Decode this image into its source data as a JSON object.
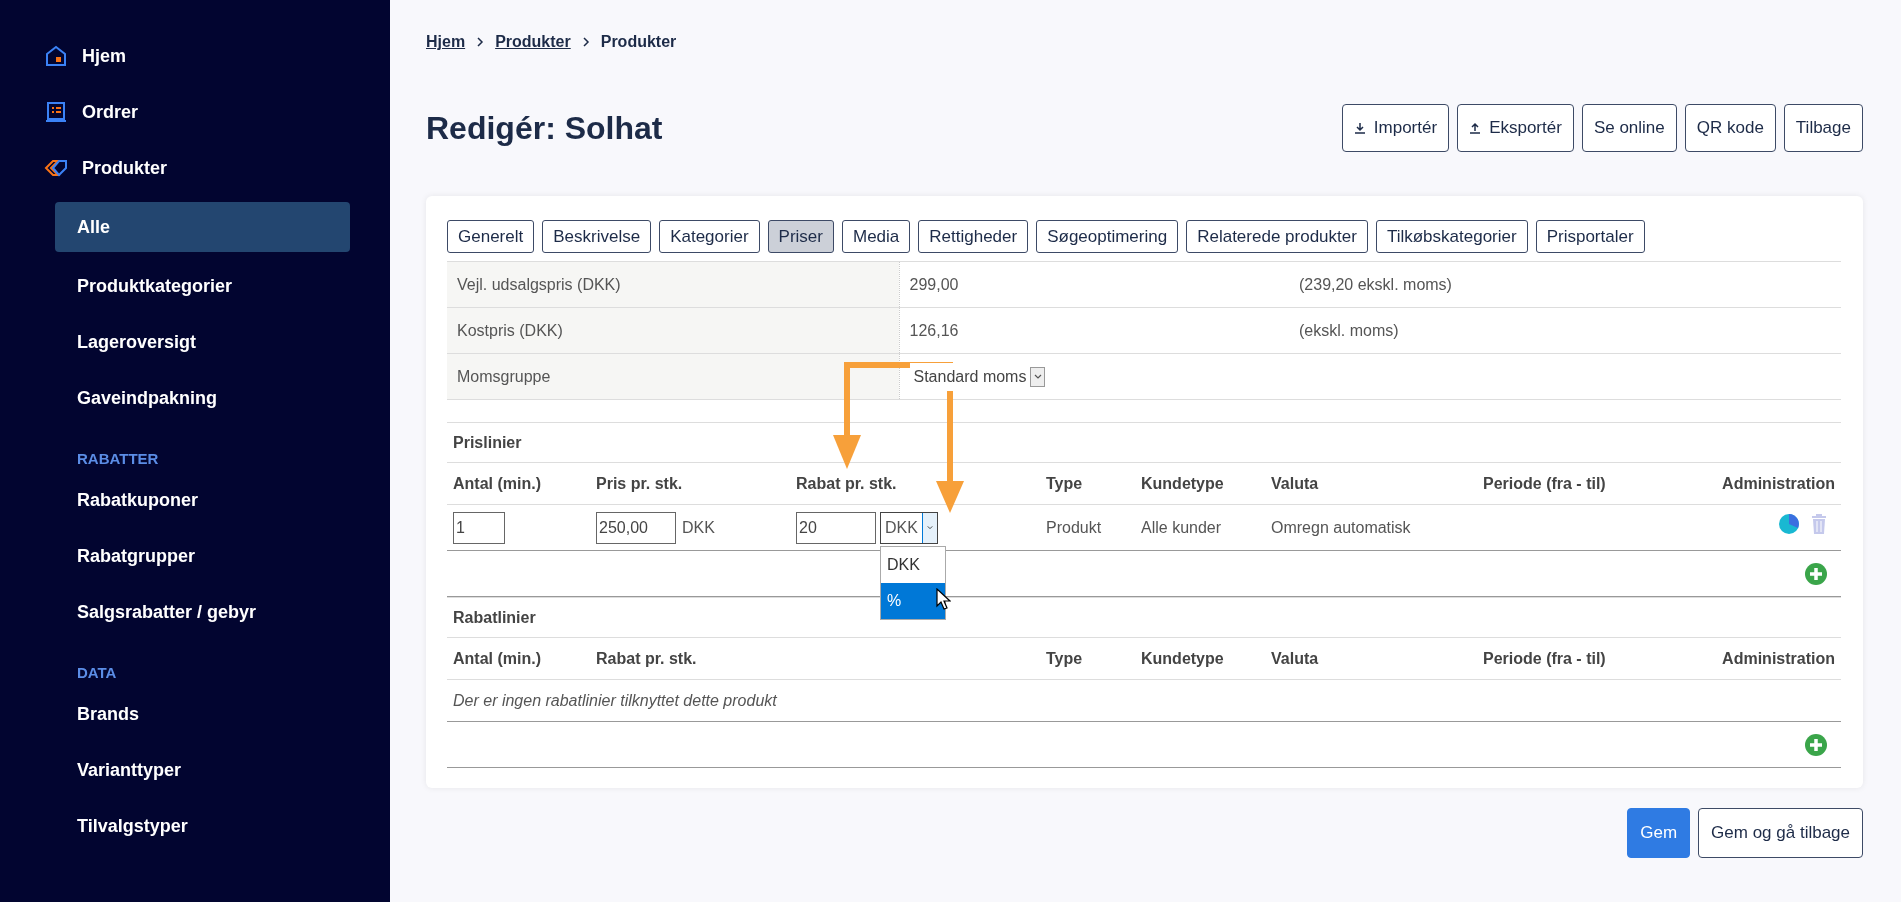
{
  "sidebar": {
    "nav": [
      {
        "label": "Hjem",
        "kind": "home"
      },
      {
        "label": "Ordrer",
        "kind": "orders"
      },
      {
        "label": "Produkter",
        "kind": "products",
        "children": [
          {
            "label": "Alle",
            "selected": true
          },
          {
            "label": "Produktkategorier",
            "selected": false
          },
          {
            "label": "Lageroversigt",
            "selected": false
          },
          {
            "label": "Gaveindpakning",
            "selected": false
          }
        ]
      }
    ],
    "sections": [
      {
        "heading": "RABATTER",
        "items": [
          {
            "label": "Rabatkuponer",
            "selected": false
          },
          {
            "label": "Rabatgrupper",
            "selected": false
          },
          {
            "label": "Salgsrabatter / gebyr",
            "selected": false
          }
        ]
      },
      {
        "heading": "DATA",
        "items": [
          {
            "label": "Brands",
            "selected": false
          },
          {
            "label": "Varianttyper",
            "selected": false
          },
          {
            "label": "Tilvalgstyper",
            "selected": false
          }
        ]
      }
    ]
  },
  "breadcrumb": [
    {
      "label": "Hjem",
      "kind": "link"
    },
    {
      "label": "Produkter",
      "kind": "link"
    },
    {
      "label": "Produkter",
      "kind": "current"
    }
  ],
  "title": "Redigér: Solhat",
  "actions": [
    {
      "label": "Importér",
      "kind": "import"
    },
    {
      "label": "Eksportér",
      "kind": "export"
    },
    {
      "label": "Se online",
      "kind": "plain"
    },
    {
      "label": "QR kode",
      "kind": "plain"
    },
    {
      "label": "Tilbage",
      "kind": "plain"
    }
  ],
  "tabs": [
    {
      "label": "Generelt",
      "selected": false
    },
    {
      "label": "Beskrivelse",
      "selected": false
    },
    {
      "label": "Kategorier",
      "selected": false
    },
    {
      "label": "Priser",
      "selected": true
    },
    {
      "label": "Media",
      "selected": false
    },
    {
      "label": "Rettigheder",
      "selected": false
    },
    {
      "label": "Søgeoptimering",
      "selected": false
    },
    {
      "label": "Relaterede produkter",
      "selected": false
    },
    {
      "label": "Tilkøbskategorier",
      "selected": false
    },
    {
      "label": "Prisportaler",
      "selected": false
    }
  ],
  "price_fields": [
    {
      "label": "Vejl. udsalgspris (DKK)",
      "kind": "text",
      "value": "299,00",
      "note": "(239,20 ekskl. moms)"
    },
    {
      "label": "Kostpris (DKK)",
      "kind": "text",
      "value": "126,16",
      "note": "(ekskl. moms)"
    },
    {
      "label": "Momsgruppe",
      "kind": "select",
      "value": "Standard moms"
    }
  ],
  "price_lines": {
    "title": "Prislinier",
    "columns": [
      "Antal (min.)",
      "Pris pr. stk.",
      "Rabat pr. stk.",
      "Type",
      "Kundetype",
      "Valuta",
      "Periode (fra - til)",
      "Administration"
    ],
    "rows": [
      {
        "quantity": "1",
        "price": "250,00",
        "price_currency": "DKK",
        "discount": "20",
        "discount_unit": "DKK",
        "type": "Produkt",
        "customer_type": "Alle kunder",
        "currency": "Omregn automatisk"
      }
    ],
    "unit_dropdown": {
      "options": [
        {
          "label": "DKK",
          "selected": false
        },
        {
          "label": "%",
          "selected": true
        }
      ]
    }
  },
  "discount_lines": {
    "title": "Rabatlinier",
    "columns": [
      "Antal (min.)",
      "Rabat pr. stk.",
      "Type",
      "Kundetype",
      "Valuta",
      "Periode (fra - til)",
      "Administration"
    ],
    "empty_message": "Der er ingen rabatlinier tilknyttet dette produkt"
  },
  "footer_buttons": [
    {
      "label": "Gem",
      "kind": "primary"
    },
    {
      "label": "Gem og gå tilbage",
      "kind": "outline"
    }
  ]
}
